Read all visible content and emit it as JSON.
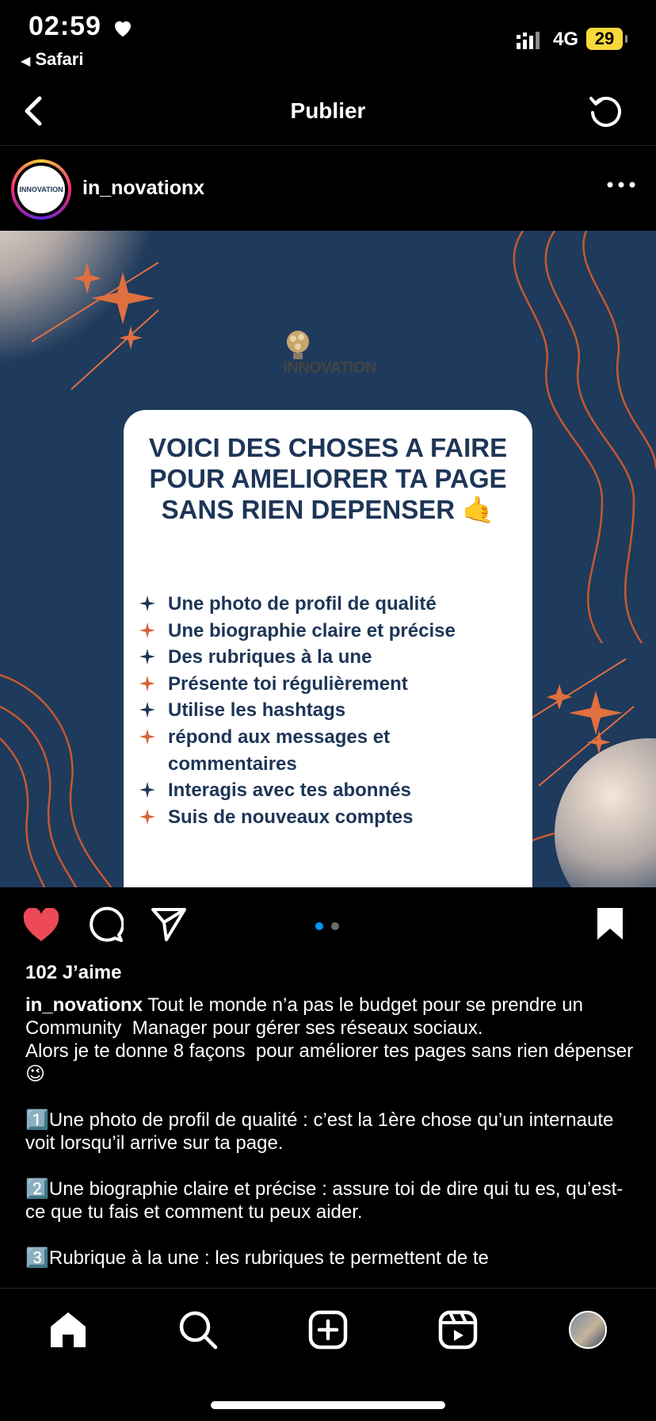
{
  "status_bar": {
    "time": "02:59",
    "back_app": "Safari",
    "network": "4G",
    "battery": "29"
  },
  "header": {
    "title": "Publier"
  },
  "post_header": {
    "username": "in_novationx",
    "avatar_text": "INNOVATION"
  },
  "post_image": {
    "brand": "INNOVATION",
    "card_title": "VOICI DES CHOSES A FAIRE POUR AMELIORER TA PAGE SANS RIEN DEPENSER",
    "card_emoji": "🤙",
    "items": [
      "Une photo de profil de qualité",
      "Une biographie claire et précise",
      "Des rubriques à la une",
      "Présente toi régulièrement",
      "Utilise les hashtags",
      "répond aux messages et commentaires",
      "Interagis avec tes abonnés",
      "Suis de nouveaux comptes"
    ],
    "colors": {
      "background": "#1e3a5c",
      "accent": "#d9623a",
      "text": "#1d3557"
    }
  },
  "carousel": {
    "count": 2,
    "active": 1
  },
  "likes": "102 J’aime",
  "caption": {
    "username": "in_novationx",
    "text": " Tout le monde n’a pas le budget pour se prendre un Community  Manager pour gérer ses réseaux sociaux.\nAlors je te donne 8 façons  pour améliorer tes pages sans rien dépenser 😉\n\n1️⃣Une photo de profil de qualité : c’est la 1ère chose qu’un internaute voit lorsqu’il arrive sur ta page.\n\n2️⃣Une biographie claire et précise : assure toi de dire qui tu es, qu’est-ce que tu fais et comment tu peux aider.\n\n3️⃣Rubrique à la une : les rubriques te permettent de te"
  },
  "tabbar": {
    "icons": [
      "home-icon",
      "search-icon",
      "create-icon",
      "reels-icon",
      "profile-avatar"
    ]
  }
}
